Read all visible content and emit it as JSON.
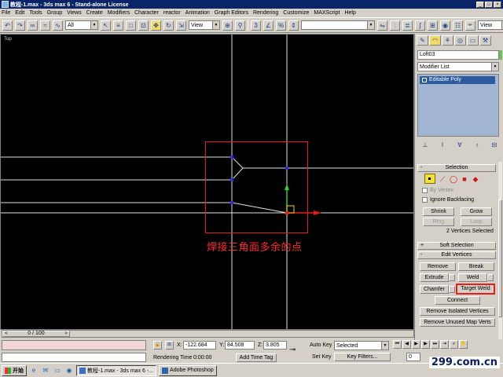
{
  "window": {
    "title": "教程-1.max - 3ds max 6 - Stand-alone License",
    "buttons": [
      "_",
      "□",
      "×"
    ]
  },
  "menu": [
    "File",
    "Edit",
    "Tools",
    "Group",
    "Views",
    "Create",
    "Modifiers",
    "Character",
    "reactor",
    "Animation",
    "Graph Editors",
    "Rendering",
    "Customize",
    "MAXScript",
    "Help"
  ],
  "toolbar": {
    "selection_filter": "All",
    "ref_coord": "View",
    "ref_coord_right": "View"
  },
  "viewport": {
    "label": "Top",
    "caption": "焊接三角面多余的点",
    "colors": {
      "background": "#000000",
      "geometry": "#e0e0e0",
      "selection_box": "#e81c1c",
      "axis_y": "#2fd02f",
      "axis_x": "#e81c1c",
      "vertex": "#2b2bd8"
    }
  },
  "command_panel": {
    "object_name": "Loft03",
    "modifier_list": "Modifier List",
    "stack_item": "Editable Poly",
    "selection": {
      "title": "Selection",
      "by_vertex": "By Vertex",
      "ignore_backfacing": "Ignore Backfacing",
      "shrink": "Shrink",
      "grow": "Grow",
      "ring": "Ring",
      "loop": "Loop",
      "status": "2 Vertices Selected"
    },
    "soft_selection": {
      "title": "Soft Selection"
    },
    "edit_vertices": {
      "title": "Edit Vertices",
      "remove": "Remove",
      "break": "Break",
      "extrude": "Extrude",
      "weld": "Weld",
      "chamfer": "Chamfer",
      "target_weld": "Target Weld",
      "connect": "Connect",
      "remove_isolated": "Remove Isolated Vertices",
      "remove_unused_map": "Remove Unused Map Verts"
    }
  },
  "timeline": {
    "frame": "0 / 100",
    "left_arrow": "<",
    "right_arrow": ">"
  },
  "status_bar": {
    "x_label": "X:",
    "x_value": "-122.684",
    "y_label": "Y:",
    "y_value": "84.508",
    "z_label": "Z:",
    "z_value": "3.805",
    "rendering_time_label": "Rendering Time",
    "rendering_time": "0:00:00",
    "add_time_tag": "Add Time Tag",
    "auto_key": "Auto Key",
    "selected": "Selected",
    "set_key": "Set Key",
    "key_filters": "Key Filters...",
    "frame_field": "0"
  },
  "taskbar": {
    "start": "开始",
    "tasks": [
      "教程-1.max - 3ds max 6 -...",
      "Adobe Photoshop"
    ],
    "watermark": "299.com.cn"
  }
}
